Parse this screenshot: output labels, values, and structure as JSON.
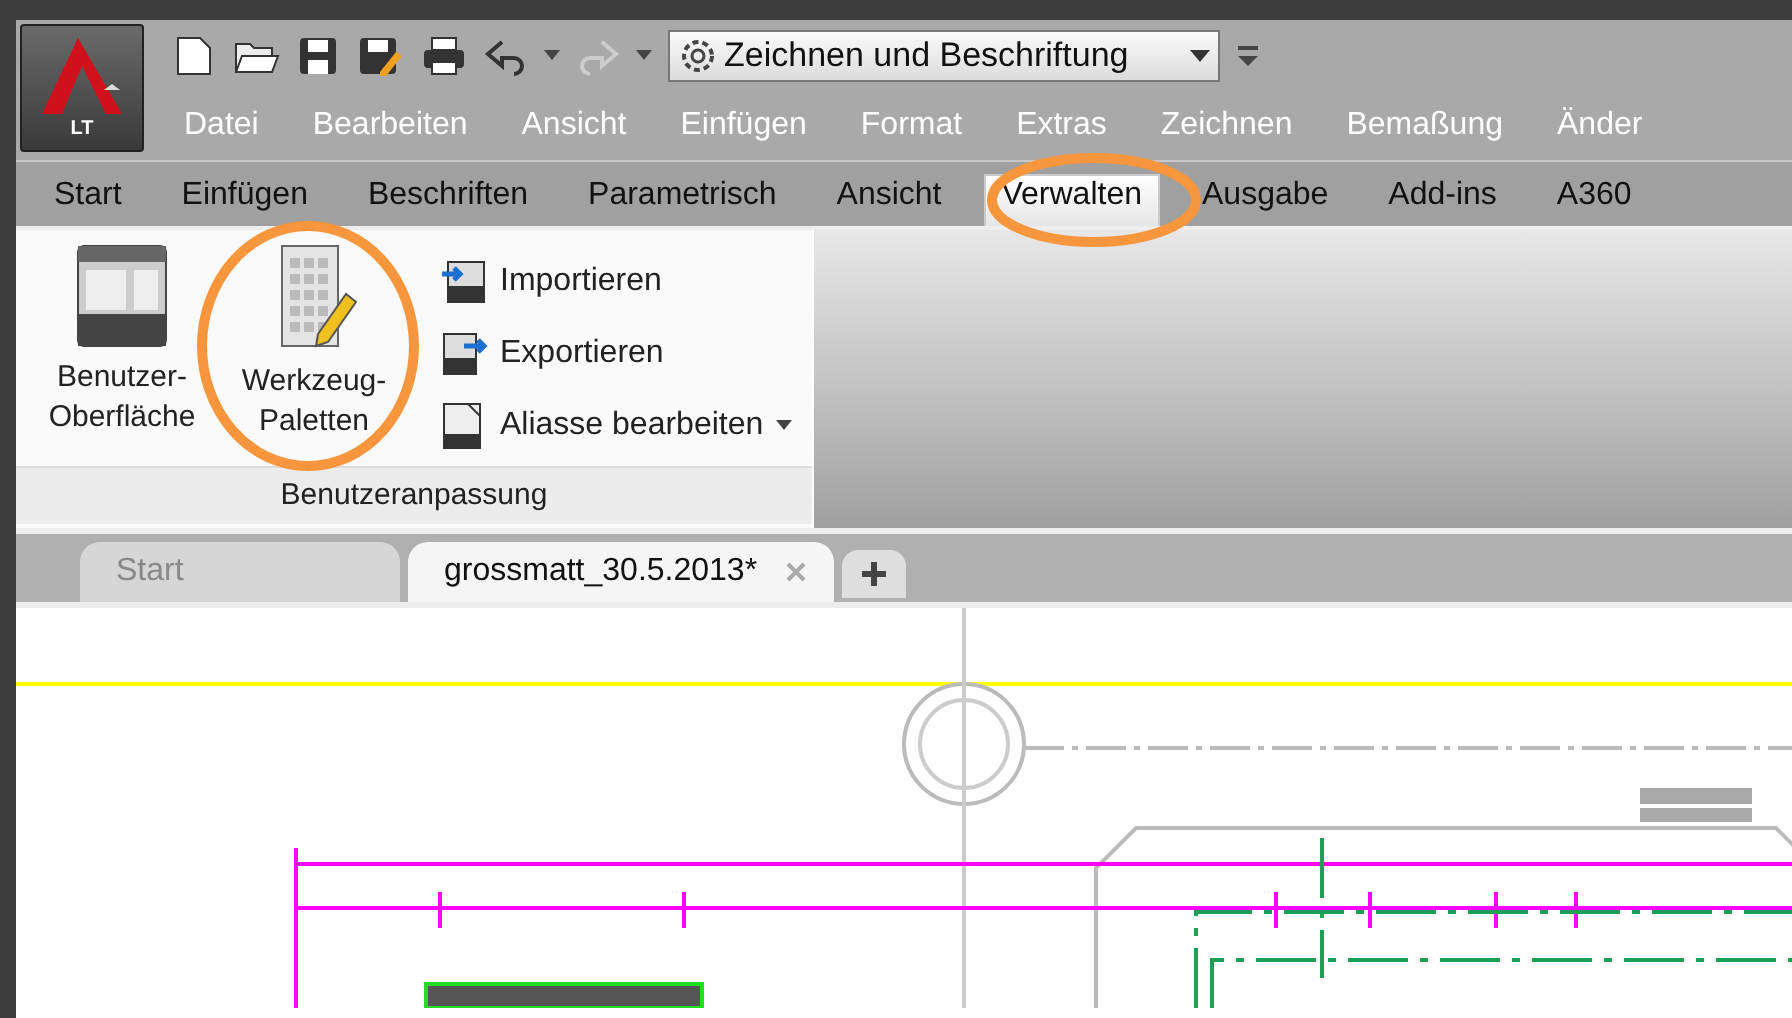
{
  "app_button": {
    "label": "LT"
  },
  "quick_access": {
    "workspace": "Zeichnen und Beschriftung"
  },
  "menu_bar": [
    "Datei",
    "Bearbeiten",
    "Ansicht",
    "Einfügen",
    "Format",
    "Extras",
    "Zeichnen",
    "Bemaßung",
    "Änder"
  ],
  "ribbon_tabs": [
    {
      "label": "Start",
      "selected": false
    },
    {
      "label": "Einfügen",
      "selected": false
    },
    {
      "label": "Beschriften",
      "selected": false
    },
    {
      "label": "Parametrisch",
      "selected": false
    },
    {
      "label": "Ansicht",
      "selected": false
    },
    {
      "label": "Verwalten",
      "selected": true
    },
    {
      "label": "Ausgabe",
      "selected": false
    },
    {
      "label": "Add-ins",
      "selected": false
    },
    {
      "label": "A360",
      "selected": false
    }
  ],
  "ribbon_panel": {
    "title": "Benutzeranpassung",
    "large_buttons": [
      {
        "label": "Benutzer-\nOberfläche",
        "kind": "cui"
      },
      {
        "label": "Werkzeug-\nPaletten",
        "kind": "palette"
      }
    ],
    "small_buttons": [
      {
        "label": "Importieren",
        "kind": "import",
        "dropdown": false
      },
      {
        "label": "Exportieren",
        "kind": "export",
        "dropdown": false
      },
      {
        "label": "Aliasse bearbeiten",
        "kind": "alias",
        "dropdown": true
      }
    ]
  },
  "document_tabs": [
    {
      "label": "Start",
      "selected": false
    },
    {
      "label": "grossmatt_30.5.2013*",
      "selected": true
    }
  ]
}
